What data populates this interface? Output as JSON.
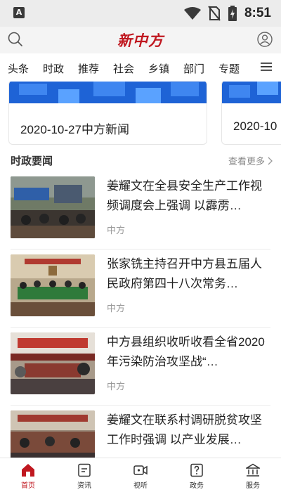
{
  "status_bar": {
    "time": "8:51",
    "app_icon_letter": "A"
  },
  "header": {
    "logo": "新中方",
    "search_icon": "search-icon",
    "user_icon": "user-icon"
  },
  "nav": {
    "tabs": [
      "头条",
      "时政",
      "推荐",
      "社会",
      "乡镇",
      "部门",
      "专题"
    ],
    "menu_icon": "hamburger-icon"
  },
  "carousel": {
    "cards": [
      {
        "caption": "2020-10-27中方新闻"
      },
      {
        "caption": "2020-10"
      }
    ]
  },
  "section": {
    "title": "时政要闻",
    "more": "查看更多"
  },
  "news": [
    {
      "headline": "姜耀文在全县安全生产工作视频调度会上强调 以霹雳…",
      "source": "中方"
    },
    {
      "headline": "张家铣主持召开中方县五届人民政府第四十八次常务…",
      "source": "中方"
    },
    {
      "headline": "中方县组织收听收看全省2020年污染防治攻坚战“…",
      "source": "中方"
    },
    {
      "headline": "姜耀文在联系村调研脱贫攻坚工作时强调 以产业发展…",
      "source": ""
    }
  ],
  "tabbar": {
    "items": [
      {
        "label": "首页",
        "icon": "home-icon",
        "active": true
      },
      {
        "label": "资讯",
        "icon": "news-icon",
        "active": false
      },
      {
        "label": "视听",
        "icon": "video-icon",
        "active": false
      },
      {
        "label": "政务",
        "icon": "government-icon",
        "active": false
      },
      {
        "label": "服务",
        "icon": "service-icon",
        "active": false
      }
    ]
  },
  "colors": {
    "brand": "#c01820",
    "banner_blue": "#1e63d6"
  }
}
